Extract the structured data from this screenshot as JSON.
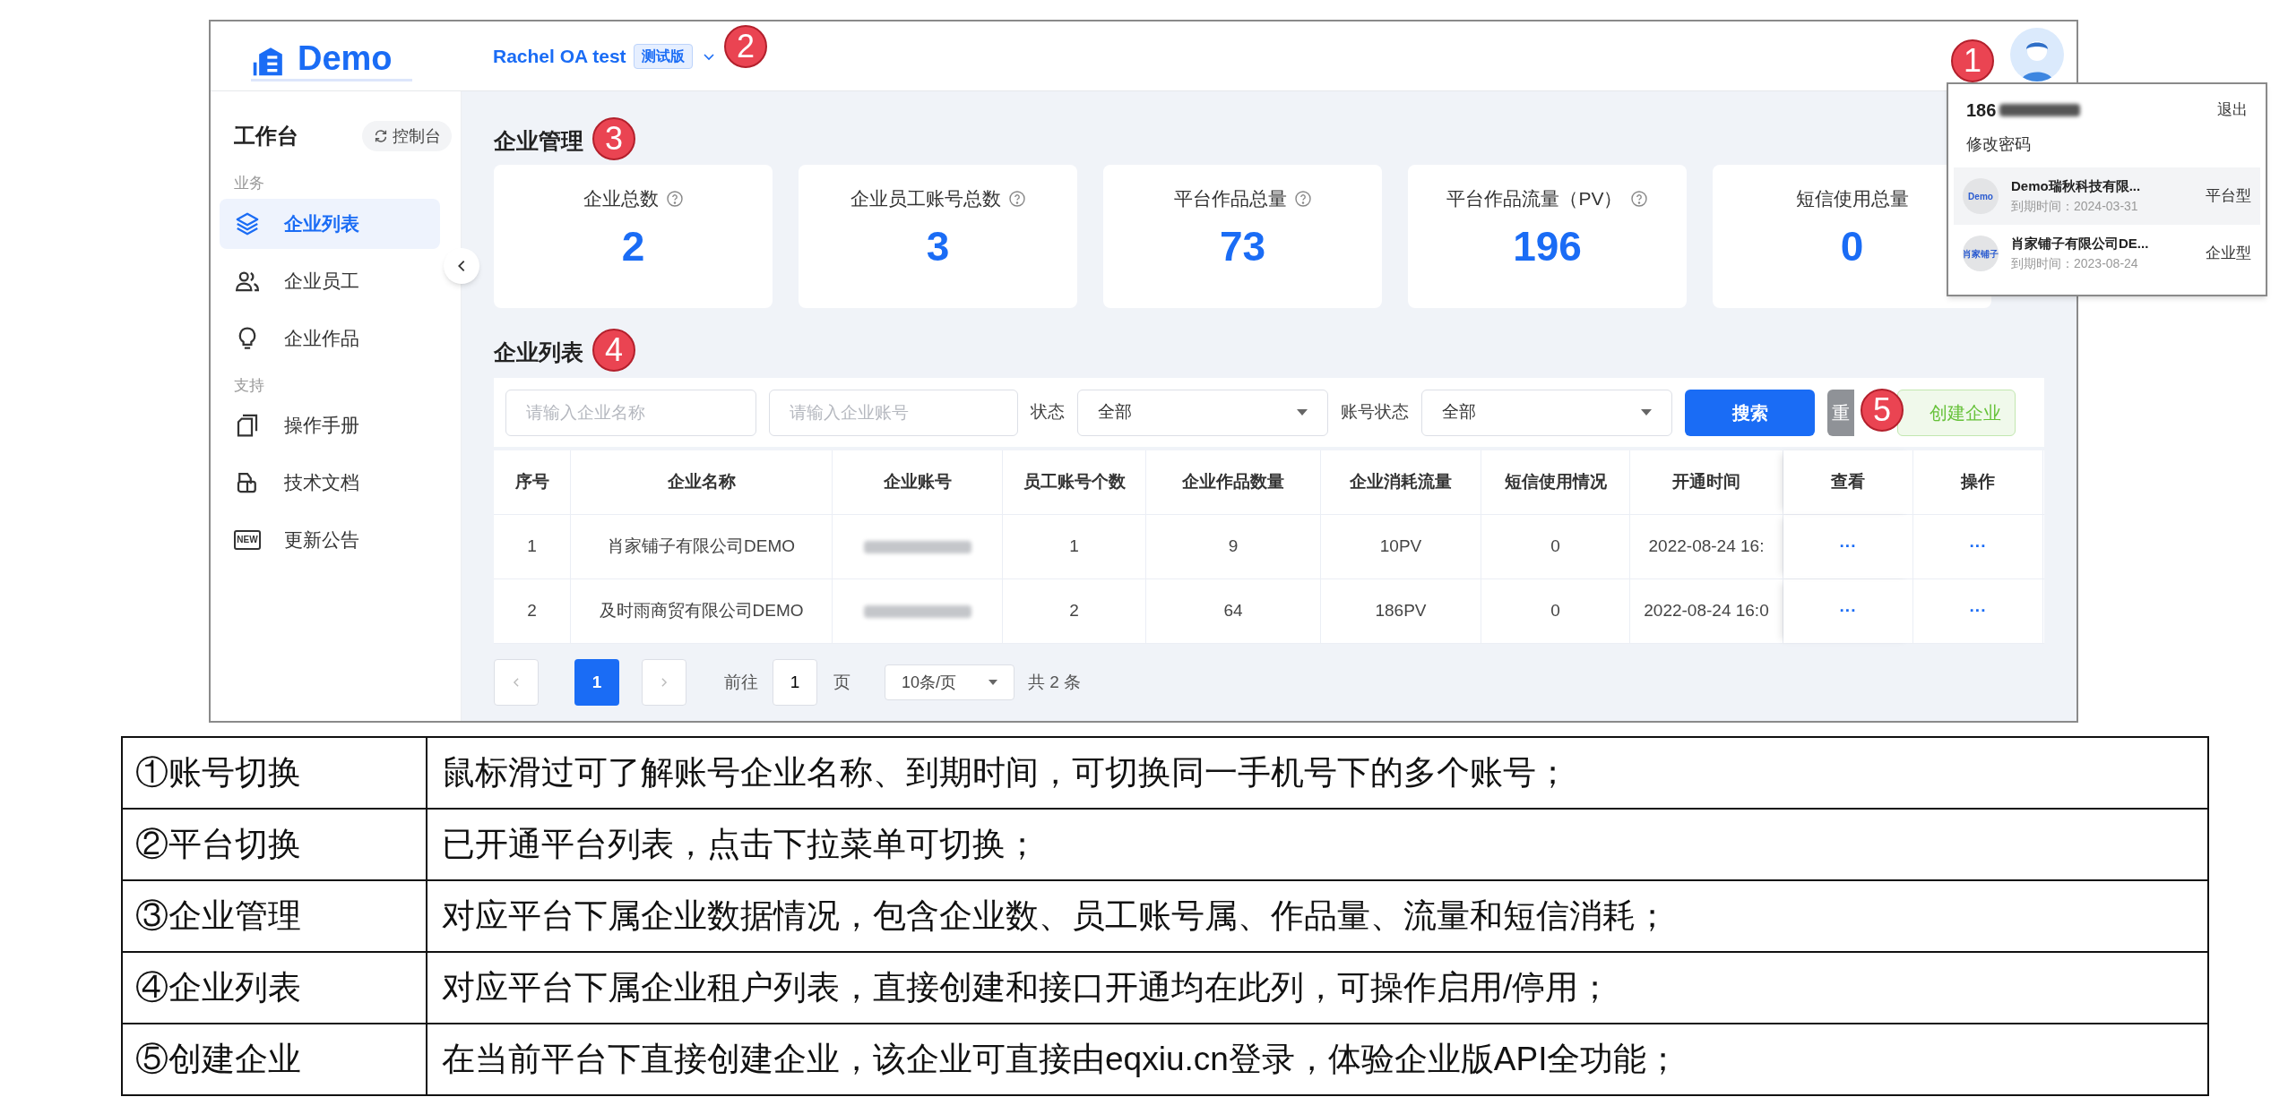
{
  "header": {
    "logo": "Demo",
    "platform": "Rachel OA test",
    "platform_tag": "测试版"
  },
  "markers": [
    {
      "label": "1"
    },
    {
      "label": "2"
    },
    {
      "label": "3"
    },
    {
      "label": "4"
    },
    {
      "label": "5"
    }
  ],
  "sidebar": {
    "title": "工作台",
    "console_button": "控制台",
    "sections": [
      {
        "heading": "业务",
        "items": [
          {
            "label": "企业列表",
            "kind": "layers",
            "selected": true
          },
          {
            "label": "企业员工",
            "kind": "people",
            "selected": false
          },
          {
            "label": "企业作品",
            "kind": "bulb",
            "selected": false
          }
        ]
      },
      {
        "heading": "支持",
        "items": [
          {
            "label": "操作手册",
            "kind": "pages",
            "selected": false
          },
          {
            "label": "技术文档",
            "kind": "doc",
            "selected": false
          },
          {
            "label": "更新公告",
            "kind": "badge",
            "badge": "NEW",
            "selected": false
          }
        ]
      }
    ]
  },
  "overview": {
    "title": "企业管理",
    "stats": [
      {
        "label": "企业总数",
        "value": "2",
        "help": true
      },
      {
        "label": "企业员工账号总数",
        "value": "3",
        "help": true
      },
      {
        "label": "平台作品总量",
        "value": "73",
        "help": true
      },
      {
        "label": "平台作品流量（PV）",
        "value": "196",
        "help": true
      },
      {
        "label": "短信使用总量",
        "value": "0",
        "help": false
      }
    ]
  },
  "list": {
    "title": "企业列表",
    "filters": {
      "name_placeholder": "请输入企业名称",
      "account_placeholder": "请输入企业账号",
      "status_label": "状态",
      "status_value": "全部",
      "account_status_label": "账号状态",
      "account_status_value": "全部",
      "search_button": "搜索",
      "reset_button": "重",
      "create_button": "创建企业"
    },
    "columns": [
      "序号",
      "企业名称",
      "企业账号",
      "员工账号个数",
      "企业作品数量",
      "企业消耗流量",
      "短信使用情况",
      "开通时间",
      "查看",
      "操作"
    ],
    "rows": [
      {
        "index": "1",
        "name": "肖家铺子有限公司DEMO",
        "staff": "1",
        "works": "9",
        "traffic": "10PV",
        "sms": "0",
        "opened": "2022-08-24 16:",
        "view": "···",
        "action": "···"
      },
      {
        "index": "2",
        "name": "及时雨商贸有限公司DEMO",
        "staff": "2",
        "works": "64",
        "traffic": "186PV",
        "sms": "0",
        "opened": "2022-08-24 16:0",
        "view": "···",
        "action": "···"
      }
    ],
    "pagination": {
      "pages": [
        {
          "label": "1",
          "selected": true
        }
      ],
      "goto_label": "前往",
      "goto_value": "1",
      "page_unit": "页",
      "page_size": "10条/页",
      "total": "共 2 条"
    }
  },
  "account_menu": {
    "phone": "186",
    "logout": "退出",
    "change_password": "修改密码",
    "accounts": [
      {
        "logo": "Demo",
        "name": "Demo瑞秋科技有限...",
        "expiry": "到期时间：2024-03-31",
        "type": "平台型",
        "selected": true
      },
      {
        "logo": "肖家铺子",
        "name": "肖家铺子有限公司DE...",
        "expiry": "到期时间：2023-08-24",
        "type": "企业型",
        "selected": false
      }
    ]
  },
  "notes": [
    {
      "term": "①账号切换",
      "description": "鼠标滑过可了解账号企业名称、到期时间，可切换同一手机号下的多个账号；"
    },
    {
      "term": "②平台切换",
      "description": "已开通平台列表，点击下拉菜单可切换；"
    },
    {
      "term": "③企业管理",
      "description": "对应平台下属企业数据情况，包含企业数、员工账号属、作品量、流量和短信消耗；"
    },
    {
      "term": "④企业列表",
      "description": "对应平台下属企业租户列表，直接创建和接口开通均在此列，可操作启用/停用；"
    },
    {
      "term": "⑤创建企业",
      "description": "在当前平台下直接创建企业，该企业可直接由eqxiu.cn登录，体验企业版API全功能；"
    }
  ]
}
